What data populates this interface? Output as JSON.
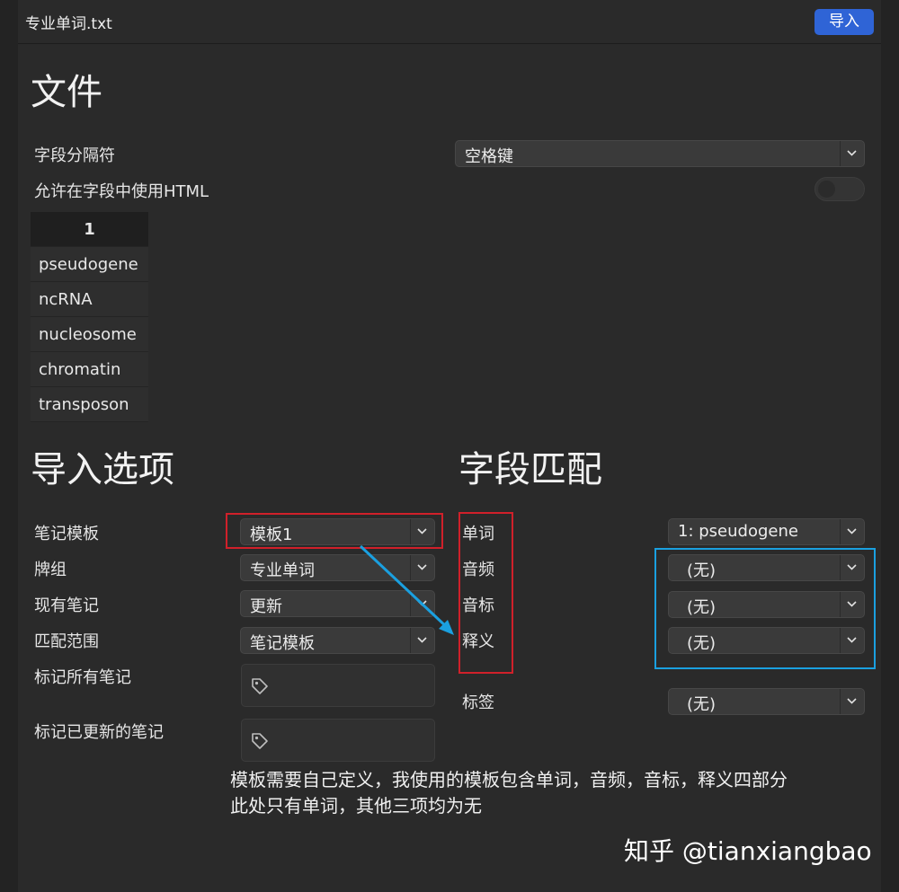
{
  "header": {
    "file_title": "专业单词.txt",
    "import_label": "导入"
  },
  "file_section": {
    "title": "文件",
    "separator_label": "字段分隔符",
    "separator_value": "空格键",
    "allow_html_label": "允许在字段中使用HTML",
    "allow_html_on": false,
    "preview": {
      "column_header": "1",
      "rows": [
        "pseudogene",
        "ncRNA",
        "nucleosome",
        "chromatin",
        "transposon"
      ]
    }
  },
  "import_options": {
    "title": "导入选项",
    "notetype_label": "笔记模板",
    "notetype_value": "模板1",
    "deck_label": "牌组",
    "deck_value": "专业单词",
    "existing_label": "现有笔记",
    "existing_value": "更新",
    "match_scope_label": "匹配范围",
    "match_scope_value": "笔记模板",
    "tag_all_label": "标记所有笔记",
    "tag_updated_label": "标记已更新的笔记"
  },
  "field_mapping": {
    "title": "字段匹配",
    "fields": [
      {
        "name": "单词",
        "value": "1: pseudogene"
      },
      {
        "name": "音频",
        "value": "(无)"
      },
      {
        "name": "音标",
        "value": "(无)"
      },
      {
        "name": "释义",
        "value": "(无)"
      }
    ],
    "tags_label": "标签",
    "tags_value": "(无)"
  },
  "annotation": {
    "line1": "模板需要自己定义，我使用的模板包含单词，音频，音标，释义四部分",
    "line2": "此处只有单词，其他三项均为无",
    "red_color": "#d0202a",
    "blue_color": "#1aa0e0"
  },
  "watermark": "知乎 @tianxiangbao",
  "colors": {
    "accent": "#2f64d6",
    "background": "#2a2a2a"
  }
}
